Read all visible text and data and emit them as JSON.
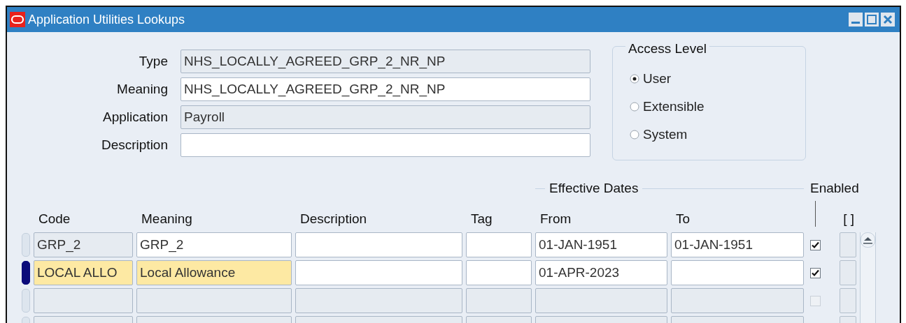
{
  "window": {
    "title": "Application Utilities Lookups"
  },
  "fields": [
    {
      "label": "Type",
      "value": "NHS_LOCALLY_AGREED_GRP_2_NR_NP",
      "readonly": true
    },
    {
      "label": "Meaning",
      "value": "NHS_LOCALLY_AGREED_GRP_2_NR_NP",
      "readonly": false
    },
    {
      "label": "Application",
      "value": "Payroll",
      "readonly": true
    },
    {
      "label": "Description",
      "readonly": false
    }
  ],
  "access_level": {
    "title": "Access Level",
    "options": [
      {
        "label": "User",
        "selected": true
      },
      {
        "label": "Extensible",
        "selected": false
      },
      {
        "label": "System",
        "selected": false
      }
    ]
  },
  "table": {
    "group_label": "Effective Dates",
    "enabled_label": "Enabled",
    "columns": [
      "Code",
      "Meaning",
      "Description",
      "Tag",
      "From",
      "To",
      "[ ]"
    ],
    "rows": [
      {
        "kind": "saved",
        "selected": false,
        "code": "GRP_2",
        "meaning": "GRP_2",
        "from": "01-JAN-1951",
        "to": "01-JAN-1951",
        "checked": true
      },
      {
        "kind": "new",
        "selected": true,
        "code": "LOCAL ALLO",
        "meaning": "Local Allowance",
        "from": "01-APR-2023",
        "checked": true
      },
      {
        "kind": "empty",
        "selected": false,
        "checked": false
      },
      {
        "kind": "empty",
        "selected": false
      }
    ]
  }
}
